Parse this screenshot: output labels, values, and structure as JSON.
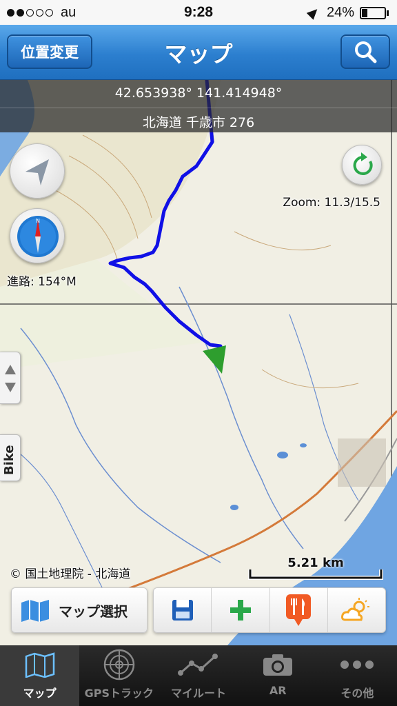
{
  "status_bar": {
    "carrier": "au",
    "time": "9:28",
    "battery_text": "24%",
    "battery_level": 0.24,
    "signal_bars": 2
  },
  "nav": {
    "left_button": "位置変更",
    "title": "マップ",
    "right_icon": "search-icon"
  },
  "map": {
    "coordinates": "42.653938° 141.414948°",
    "address": "北海道 千歳市 276",
    "heading": "進路: 154°M",
    "zoom": "Zoom: 11.3/15.5",
    "side_tab_label": "Bike",
    "copyright": "© 国土地理院 - 北海道",
    "scale": "5.21 km",
    "route_color": "#1010e6",
    "marker_color": "#2e9e2e"
  },
  "toolbar": {
    "map_select_label": "マップ選択",
    "actions": [
      "save-icon",
      "add-icon",
      "restaurant-icon",
      "weather-icon"
    ]
  },
  "tabs": [
    {
      "label": "マップ",
      "icon": "map-icon",
      "active": true
    },
    {
      "label": "GPSトラック",
      "icon": "radar-icon",
      "active": false
    },
    {
      "label": "マイルート",
      "icon": "route-icon",
      "active": false
    },
    {
      "label": "AR",
      "icon": "camera-icon",
      "active": false
    },
    {
      "label": "その他",
      "icon": "more-icon",
      "active": false
    }
  ]
}
